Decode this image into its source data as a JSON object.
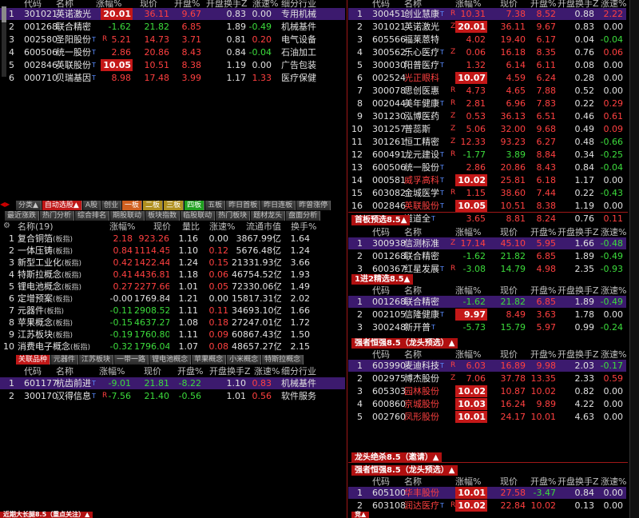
{
  "panel_a": {
    "headers": [
      "代码",
      "名称",
      "涨幅%",
      "现价",
      "开盘%",
      "开盘换手Z",
      "涨速%",
      "细分行业"
    ],
    "rows": [
      {
        "no": "1",
        "code": "301021",
        "name": "英诺激光",
        "mark": "Z",
        "chg": "20.01",
        "price": "36.11",
        "open": "9.67",
        "turn": "0.83",
        "speed": "0.00",
        "ind": "专用机械",
        "hl": true,
        "selected": true
      },
      {
        "no": "2",
        "code": "001268",
        "name": "联合精密",
        "mark": "",
        "chg": "-1.62",
        "price": "21.82",
        "open": "6.85",
        "turn": "1.89",
        "speed": "-0.49",
        "ind": "机械基件"
      },
      {
        "no": "3",
        "code": "002580",
        "name": "圣阳股份",
        "sup": "T",
        "mark": "R",
        "chg": "5.21",
        "price": "14.73",
        "open": "3.71",
        "turn": "0.81",
        "speed": "0.20",
        "ind": "电气设备"
      },
      {
        "no": "4",
        "code": "600506",
        "name": "统一股份",
        "sup": "T",
        "mark": "",
        "chg": "2.86",
        "price": "20.86",
        "open": "8.43",
        "turn": "0.84",
        "speed": "-0.04",
        "ind": "石油加工"
      },
      {
        "no": "5",
        "code": "002846",
        "name": "英联股份",
        "sup": "T",
        "mark": "",
        "chg": "10.05",
        "price": "10.51",
        "open": "8.38",
        "turn": "1.19",
        "speed": "0.00",
        "ind": "广告包装",
        "hl": true
      },
      {
        "no": "6",
        "code": "000710",
        "name": "贝瑞基因",
        "sup": "T",
        "mark": "",
        "chg": "8.98",
        "price": "17.48",
        "open": "3.99",
        "turn": "1.17",
        "speed": "1.33",
        "ind": "医疗保健"
      }
    ]
  },
  "tabs_row1": [
    "分类▲",
    "自动选股▲",
    "A股",
    "创业",
    "一板",
    "二板",
    "三板",
    "四板",
    "五板",
    "昨日首板",
    "昨日连板",
    "昨曾涨停"
  ],
  "tabs_row2": [
    "最近涨跌",
    "热门分析",
    "综合排名",
    "期股联动",
    "板块指数",
    "临股联动",
    "热门板块",
    "题材龙头",
    "盘面分析"
  ],
  "panel_b": {
    "title": "名称(19)",
    "headers": [
      "名称(19)",
      "涨幅%",
      "现价",
      "量比",
      "涨速%",
      "流通市值",
      "换手%"
    ],
    "rows": [
      {
        "no": "1",
        "name": "复合铜箔",
        "tag": "(板指)",
        "chg": "2.18",
        "price": "923.26",
        "vr": "1.16",
        "speed": "0.00",
        "mcap": "3867.99亿",
        "turn": "1.64"
      },
      {
        "no": "2",
        "name": "一体压铸",
        "tag": "(板指)",
        "chg": "0.84",
        "price": "1114.45",
        "vr": "1.10",
        "speed": "0.12",
        "mcap": "5676.48亿",
        "turn": "1.24"
      },
      {
        "no": "3",
        "name": "新型工业化",
        "tag": "(板指)",
        "chg": "0.42",
        "price": "1422.44",
        "vr": "1.24",
        "speed": "0.15",
        "mcap": "21331.93亿",
        "turn": "3.66"
      },
      {
        "no": "4",
        "name": "特斯拉概念",
        "tag": "(板指)",
        "chg": "0.41",
        "price": "4436.81",
        "vr": "1.18",
        "speed": "0.06",
        "mcap": "46754.52亿",
        "turn": "1.93"
      },
      {
        "no": "5",
        "name": "锂电池概念",
        "tag": "(板指)",
        "chg": "0.27",
        "price": "2277.66",
        "vr": "1.01",
        "speed": "0.05",
        "mcap": "72330.06亿",
        "turn": "1.49"
      },
      {
        "no": "6",
        "name": "定增预案",
        "tag": "(板指)",
        "chg": "-0.00",
        "price": "1769.84",
        "vr": "1.21",
        "speed": "0.00",
        "mcap": "15817.31亿",
        "turn": "2.02"
      },
      {
        "no": "7",
        "name": "元器件",
        "tag": "(板指)",
        "chg": "-0.11",
        "price": "2908.52",
        "vr": "1.11",
        "speed": "0.11",
        "mcap": "34693.10亿",
        "turn": "1.66"
      },
      {
        "no": "8",
        "name": "苹果概念",
        "tag": "(板指)",
        "chg": "-0.15",
        "price": "4637.27",
        "vr": "1.08",
        "speed": "0.18",
        "mcap": "27247.01亿",
        "turn": "1.72"
      },
      {
        "no": "9",
        "name": "江苏板块",
        "tag": "(板指)",
        "chg": "-0.19",
        "price": "1760.80",
        "vr": "1.11",
        "speed": "0.09",
        "mcap": "60867.43亿",
        "turn": "1.50"
      },
      {
        "no": "10",
        "name": "消费电子概念",
        "tag": "(板指)",
        "chg": "-0.32",
        "price": "1796.04",
        "vr": "1.07",
        "speed": "0.08",
        "mcap": "48657.27亿",
        "turn": "2.15"
      }
    ]
  },
  "tabs_row3": [
    "关联品种",
    "元器件",
    "江苏板块",
    "一带一路",
    "锂电池概念",
    "苹果概念",
    "小米概念",
    "特斯拉概念"
  ],
  "panel_c": {
    "headers": [
      "代码",
      "名称",
      "涨幅%",
      "现价",
      "开盘%",
      "开盘换手Z",
      "涨速%",
      "细分行业"
    ],
    "rows": [
      {
        "no": "1",
        "code": "601177",
        "name": "杭齿前进",
        "sup": "T",
        "chg": "-9.01",
        "price": "21.81",
        "open": "-8.22",
        "turn": "1.10",
        "speed": "0.83",
        "ind": "机械基件",
        "selected": true
      },
      {
        "no": "2",
        "code": "300170",
        "name": "汉得信息",
        "sup": "T",
        "mark": "R",
        "chg": "-7.56",
        "price": "21.40",
        "open": "-0.56",
        "turn": "1.01",
        "speed": "0.56",
        "ind": "软件服务"
      }
    ]
  },
  "bottom_left_label": "近期大长腿8.5（重点关注）▲",
  "panel_d": {
    "headers": [
      "代码",
      "名称",
      "涨幅%",
      "现价",
      "开盘%",
      "开盘换手Z",
      "涨速%"
    ],
    "rows": [
      {
        "no": "1",
        "code": "300451",
        "name": "创业慧康",
        "sup": "T",
        "mark": "R",
        "chg": "10.31",
        "price": "7.38",
        "open": "8.52",
        "turn": "0.88",
        "speed": "2.22",
        "selected": true
      },
      {
        "no": "2",
        "code": "301021",
        "name": "英诺激光",
        "mark": "Z",
        "chg": "20.01",
        "price": "36.11",
        "open": "9.67",
        "turn": "0.83",
        "speed": "0.00",
        "hl": true
      },
      {
        "no": "3",
        "code": "605566",
        "name": "福莱蒽特",
        "chg": "4.02",
        "price": "19.40",
        "open": "6.17",
        "turn": "0.04",
        "speed": "-0.04"
      },
      {
        "no": "4",
        "code": "300562",
        "name": "乐心医疗",
        "sup": "T",
        "mark": "Z",
        "chg": "0.06",
        "price": "16.18",
        "open": "8.35",
        "turn": "0.76",
        "speed": "0.06"
      },
      {
        "no": "5",
        "code": "300030",
        "name": "阳普医疗",
        "sup": "T",
        "chg": "1.32",
        "price": "6.14",
        "open": "6.11",
        "turn": "0.08",
        "speed": "0.00"
      },
      {
        "no": "6",
        "code": "002524",
        "name": "光正眼科",
        "chg": "10.07",
        "price": "4.59",
        "open": "6.24",
        "turn": "0.28",
        "speed": "0.00",
        "hl": true,
        "redname": true
      },
      {
        "no": "7",
        "code": "300078",
        "name": "思创医惠",
        "mark": "R",
        "chg": "4.73",
        "price": "4.65",
        "open": "7.88",
        "turn": "0.52",
        "speed": "0.00"
      },
      {
        "no": "8",
        "code": "002044",
        "name": "美年健康",
        "sup": "T",
        "mark": "R",
        "chg": "2.81",
        "price": "6.96",
        "open": "7.83",
        "turn": "0.22",
        "speed": "0.29"
      },
      {
        "no": "9",
        "code": "301230",
        "name": "泓博医药",
        "mark": "Z",
        "chg": "0.53",
        "price": "36.13",
        "open": "6.51",
        "turn": "0.46",
        "speed": "0.61"
      },
      {
        "no": "10",
        "code": "301257",
        "name": "普蕊斯",
        "mark": "Z",
        "chg": "5.06",
        "price": "32.00",
        "open": "9.68",
        "turn": "0.49",
        "speed": "0.09"
      },
      {
        "no": "11",
        "code": "301261",
        "name": "恒工精密",
        "mark": "Z",
        "chg": "12.33",
        "price": "93.23",
        "open": "6.27",
        "turn": "0.48",
        "speed": "-0.66"
      },
      {
        "no": "12",
        "code": "600491",
        "name": "龙元建设",
        "sup": "T",
        "mark": "R",
        "chg": "-1.77",
        "price": "3.89",
        "open": "8.84",
        "turn": "0.34",
        "speed": "-0.25"
      },
      {
        "no": "13",
        "code": "600506",
        "name": "统一股份",
        "sup": "T",
        "chg": "2.86",
        "price": "20.86",
        "open": "8.43",
        "turn": "0.84",
        "speed": "-0.04"
      },
      {
        "no": "14",
        "code": "000581",
        "name": "威孚高科",
        "sup": "T",
        "chg": "10.02",
        "price": "25.81",
        "open": "6.18",
        "turn": "1.17",
        "speed": "0.00",
        "hl": true,
        "redname": true
      },
      {
        "no": "15",
        "code": "603082",
        "name": "金城医学",
        "sup": "T",
        "mark": "R",
        "chg": "1.15",
        "price": "38.60",
        "open": "7.44",
        "turn": "0.22",
        "speed": "-0.43"
      },
      {
        "no": "16",
        "code": "002846",
        "name": "英联股份",
        "sup": "T",
        "chg": "10.05",
        "price": "10.51",
        "open": "8.38",
        "turn": "1.19",
        "speed": "0.00",
        "hl": true,
        "redname": true
      },
      {
        "no": "17",
        "code": "300096",
        "name": "道道全",
        "sup": "T",
        "chg": "3.65",
        "price": "8.81",
        "open": "8.24",
        "turn": "0.76",
        "speed": "0.11"
      }
    ]
  },
  "panel_e": {
    "label": "首板预选8.5▲",
    "rows": [
      {
        "no": "1",
        "code": "300938",
        "name": "信测标准",
        "mark": "Z",
        "chg": "17.14",
        "price": "45.10",
        "open": "5.95",
        "turn": "1.66",
        "speed": "-0.48",
        "selected": true
      },
      {
        "no": "2",
        "code": "001268",
        "name": "联合精密",
        "chg": "-1.62",
        "price": "21.82",
        "open": "6.85",
        "turn": "1.89",
        "speed": "-0.49"
      },
      {
        "no": "3",
        "code": "600367",
        "name": "红星发展",
        "sup": "T",
        "mark": "R",
        "chg": "-3.08",
        "price": "14.79",
        "open": "4.98",
        "turn": "2.35",
        "speed": "-0.93"
      }
    ]
  },
  "panel_f": {
    "label": "1进2精选8.5▲",
    "rows": [
      {
        "no": "1",
        "code": "001268",
        "name": "联合精密",
        "chg": "-1.62",
        "price": "21.82",
        "open": "6.85",
        "turn": "1.89",
        "speed": "-0.49",
        "selected": true
      },
      {
        "no": "2",
        "code": "002105",
        "name": "信隆健康",
        "sup": "T",
        "chg": "9.97",
        "price": "8.49",
        "open": "3.63",
        "turn": "1.78",
        "speed": "0.00",
        "hl": true
      },
      {
        "no": "3",
        "code": "300248",
        "name": "新开普",
        "sup": "T",
        "chg": "-5.73",
        "price": "15.79",
        "open": "5.97",
        "turn": "0.99",
        "speed": "-0.24"
      }
    ]
  },
  "panel_g": {
    "label": "强者恒强8.5（龙头预选）▲",
    "rows": [
      {
        "no": "1",
        "code": "603990",
        "name": "麦迪科技",
        "sup": "T",
        "mark": "R",
        "chg": "6.03",
        "price": "16.89",
        "open": "9.98",
        "turn": "2.03",
        "speed": "-0.17",
        "selected": true
      },
      {
        "no": "2",
        "code": "002975",
        "name": "博杰股份",
        "mark": "Z",
        "chg": "7.06",
        "price": "37.78",
        "open": "13.35",
        "turn": "2.33",
        "speed": "0.59"
      },
      {
        "no": "3",
        "code": "605303",
        "name": "园林股份",
        "chg": "10.02",
        "price": "10.87",
        "open": "10.02",
        "turn": "0.82",
        "speed": "0.00",
        "hl": true,
        "redname": true
      },
      {
        "no": "4",
        "code": "600860",
        "name": "京城股份",
        "chg": "10.03",
        "price": "16.24",
        "open": "9.89",
        "turn": "4.22",
        "speed": "0.00",
        "hl": true,
        "redname": true
      },
      {
        "no": "5",
        "code": "002760",
        "name": "凤形股份",
        "chg": "10.01",
        "price": "24.17",
        "open": "10.01",
        "turn": "4.63",
        "speed": "0.00",
        "hl": true,
        "redname": true
      }
    ]
  },
  "label_h": "龙头绝杀8.5（邀请）▲",
  "panel_i": {
    "label": "强者恒强8.5（龙头预选）▲",
    "rows": [
      {
        "no": "1",
        "code": "605100",
        "name": "华丰股份",
        "chg": "10.01",
        "price": "27.58",
        "open": "-3.47",
        "turn": "0.84",
        "speed": "0.00",
        "hl": true,
        "selected": true,
        "redname": true
      },
      {
        "no": "2",
        "code": "603108",
        "name": "润达医疗",
        "sup": "T",
        "mark": "R",
        "chg": "10.02",
        "price": "22.84",
        "open": "10.02",
        "turn": "0.13",
        "speed": "0.00",
        "hl": true,
        "redname": true
      }
    ]
  },
  "bottom_right_label": "竞▲"
}
